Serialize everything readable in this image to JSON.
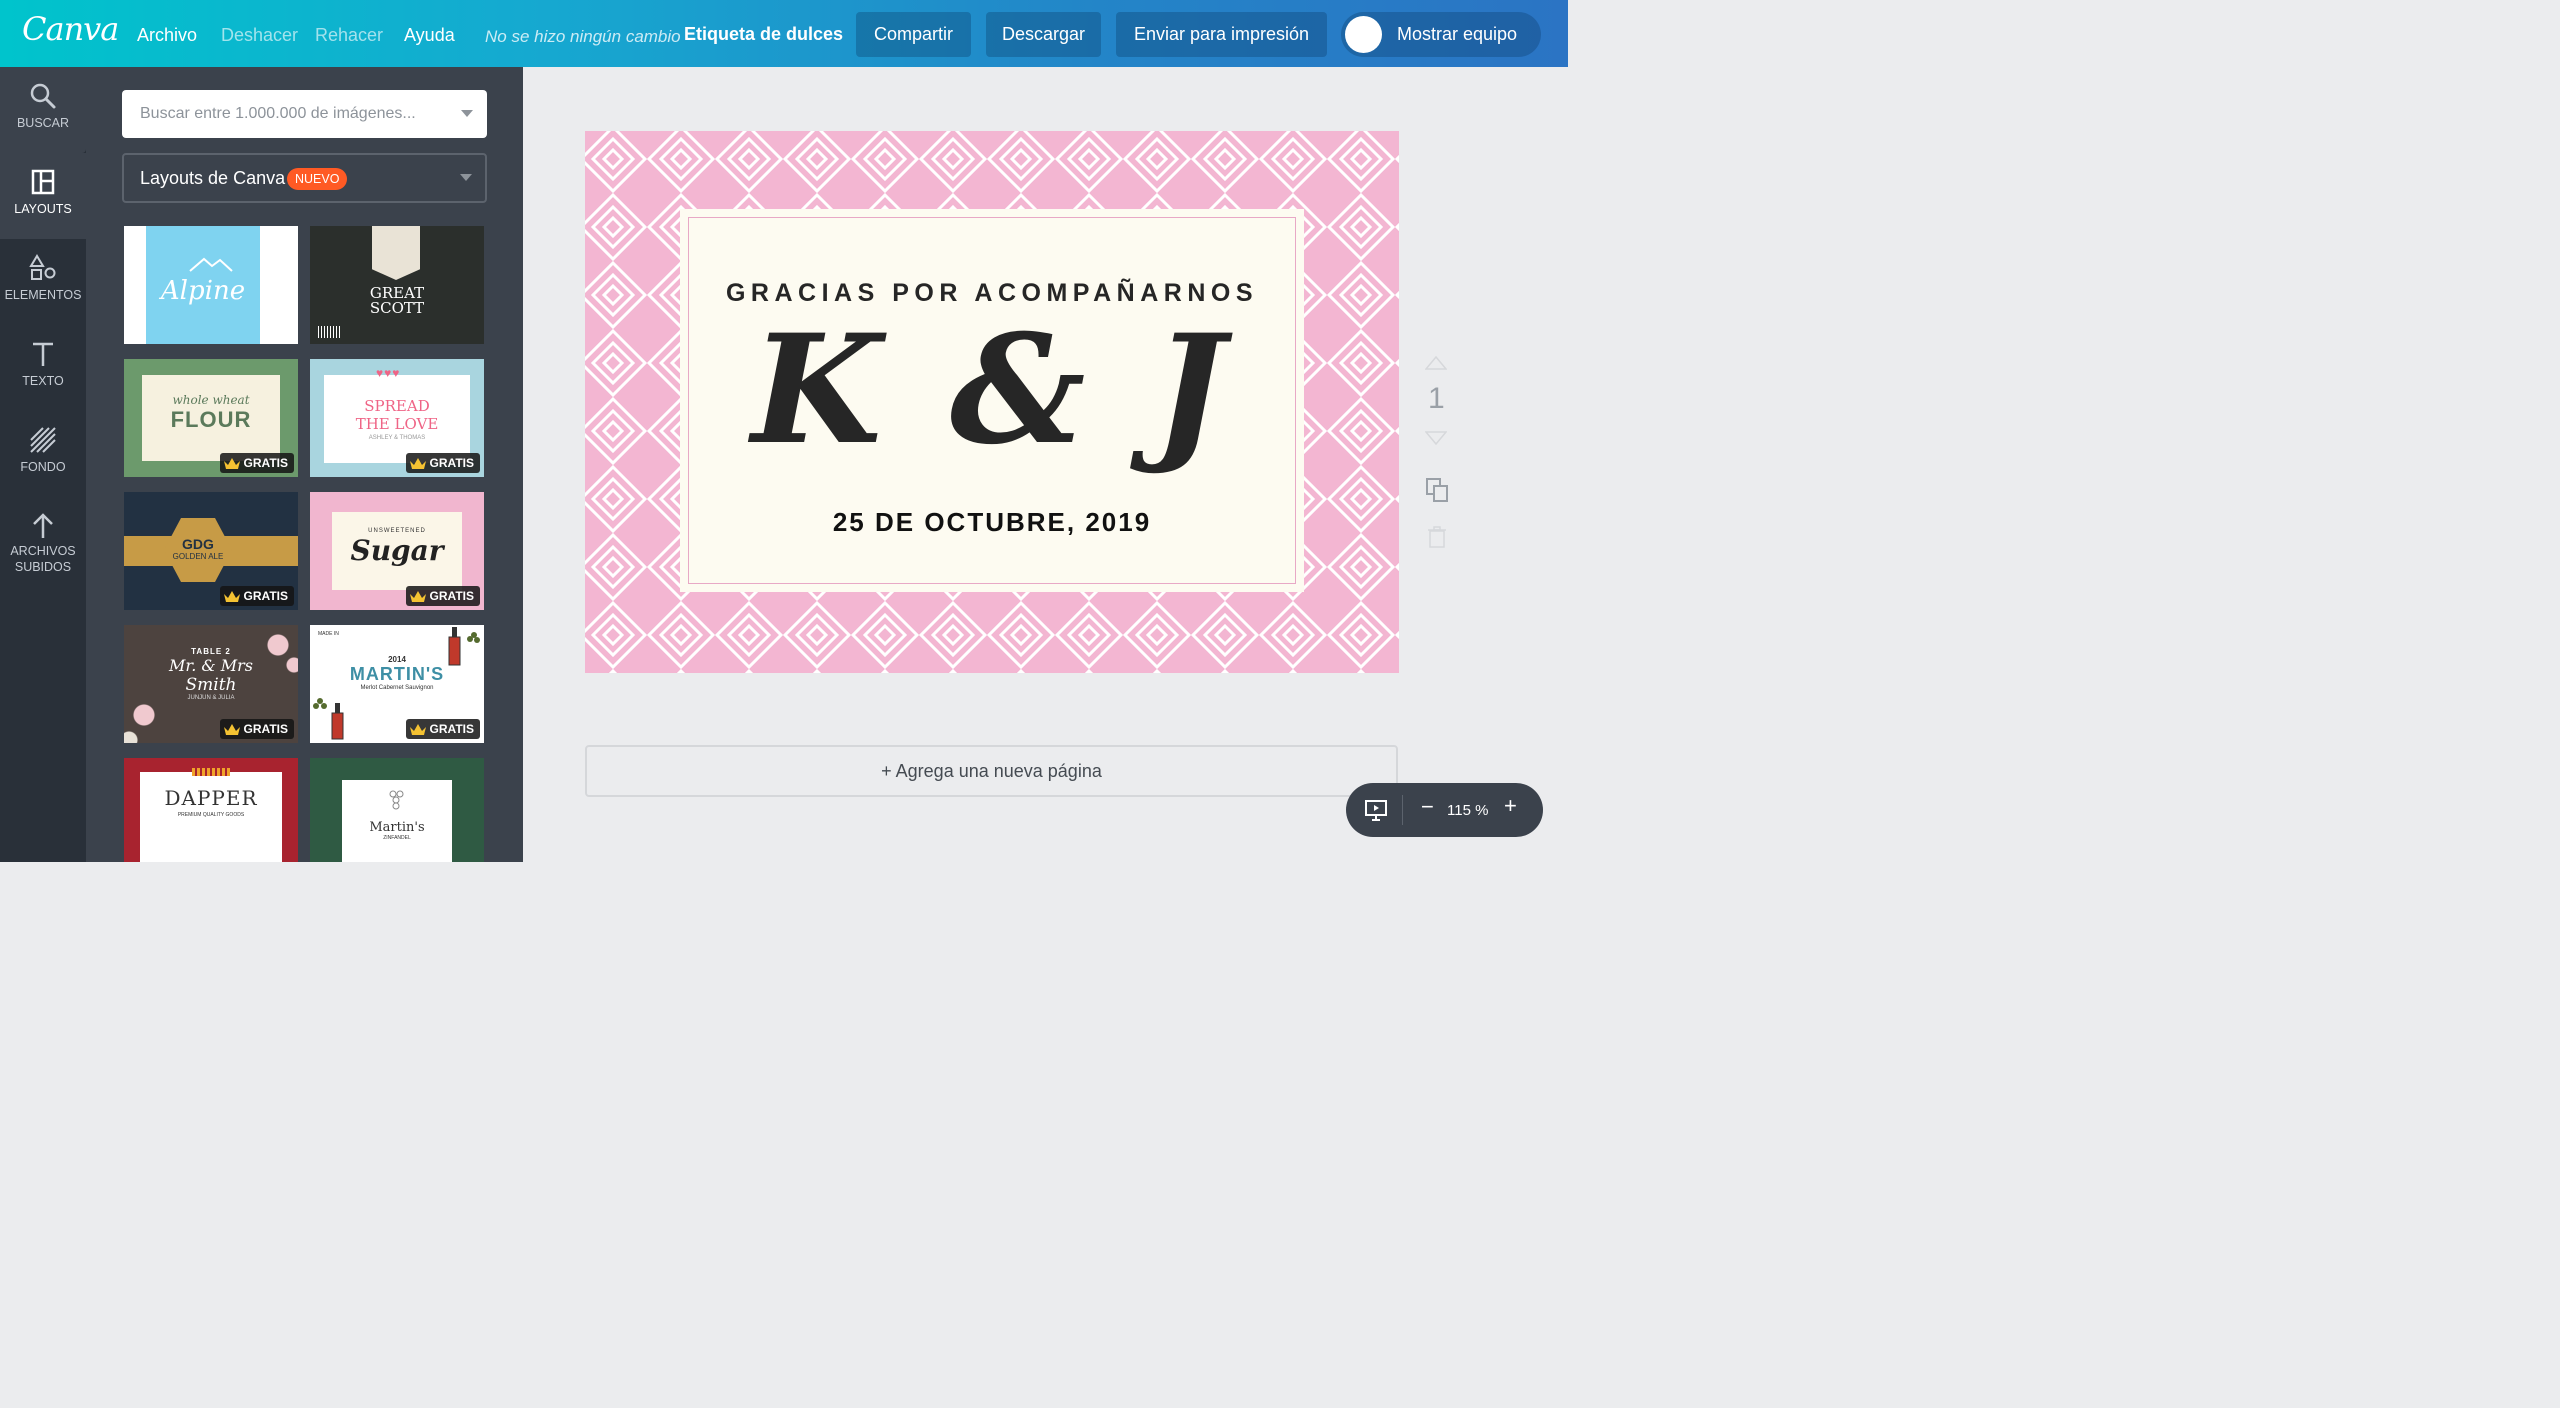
{
  "topbar": {
    "logo": "Canva",
    "menu": [
      "Archivo",
      "Deshacer",
      "Rehacer",
      "Ayuda"
    ],
    "status": "No se hizo ningún cambio",
    "document_title": "Etiqueta de dulces",
    "buttons": {
      "share": "Compartir",
      "download": "Descargar",
      "print": "Enviar para impresión",
      "team": "Mostrar equipo"
    }
  },
  "rail": [
    {
      "label": "BUSCAR",
      "icon": "search-icon"
    },
    {
      "label": "LAYOUTS",
      "icon": "layouts-icon"
    },
    {
      "label": "ELEMENTOS",
      "icon": "elements-icon"
    },
    {
      "label": "TEXTO",
      "icon": "text-icon"
    },
    {
      "label": "FONDO",
      "icon": "background-icon"
    },
    {
      "label": "ARCHIVOS",
      "label2": "SUBIDOS",
      "icon": "upload-icon"
    }
  ],
  "panel": {
    "search_placeholder": "Buscar entre 1.000.000 de imágenes...",
    "layout_select": "Layouts de Canva",
    "new_badge": "NUEVO",
    "free_label": "GRATIS",
    "templates": {
      "alpine": {
        "title": "Alpine"
      },
      "great_scott": {
        "title": "GREAT SCOTT"
      },
      "flour": {
        "line1": "whole wheat",
        "line2": "FLOUR"
      },
      "spread": {
        "line1": "SPREAD",
        "line2": "THE LOVE",
        "line3": "ASHLEY & THOMAS"
      },
      "gdg": {
        "line1": "GDG",
        "line2": "GOLDEN ALE"
      },
      "sugar": {
        "line1": "UNSWEETENED",
        "line2": "Sugar"
      },
      "smith": {
        "line1": "TABLE 2",
        "line2": "Mr. & Mrs",
        "line3": "Smith",
        "line4": "JUNJUN & JULIA"
      },
      "martins": {
        "line1": "MADE IN",
        "line2": "2014",
        "line3": "MARTIN'S",
        "line4": "Merlot Cabernet Sauvignon"
      },
      "dapper": {
        "line1": "DAPPER",
        "line2": "PREMIUM QUALITY GOODS"
      },
      "martins2": {
        "line1": "Martin's",
        "line2": "ZINFANDEL"
      }
    }
  },
  "design": {
    "headline": "GRACIAS POR ACOMPAÑARNOS",
    "monogram": "K & J",
    "date": "25 DE OCTUBRE, 2019",
    "colors": {
      "pattern_bg": "#f3b6d2",
      "pattern_line": "#ffffff",
      "card_bg": "#fdfbf1",
      "text": "#262626"
    }
  },
  "page": {
    "number": "1"
  },
  "add_page": "+ Agrega una nueva página",
  "zoom": {
    "value": "115 %"
  }
}
